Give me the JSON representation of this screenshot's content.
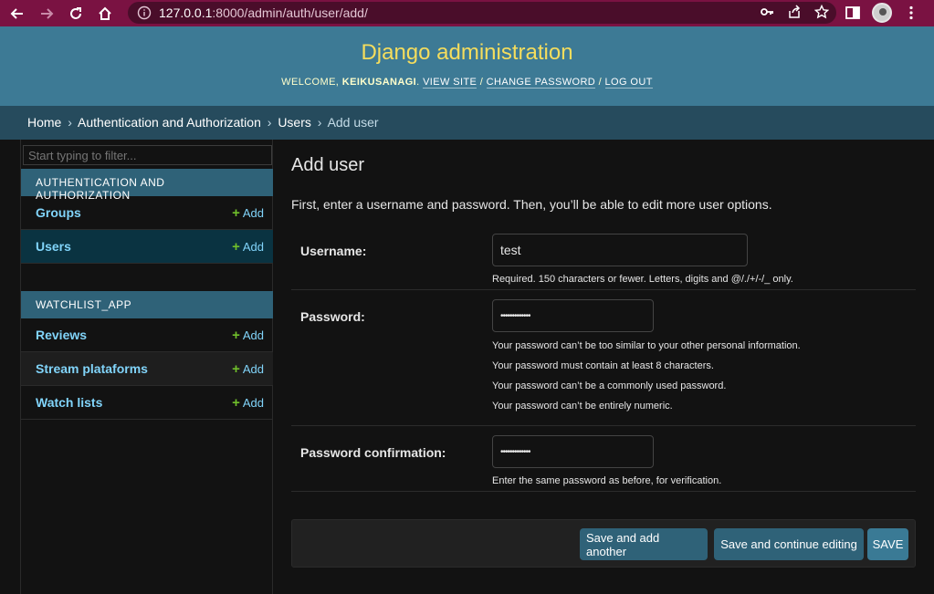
{
  "browser": {
    "url_host": "127.0.0.1",
    "url_path": ":8000/admin/auth/user/add/"
  },
  "header": {
    "site_title": "Django administration",
    "welcome": "WELCOME,",
    "username": "KEIKUSANAGI",
    "view_site": "VIEW SITE",
    "change_password": "CHANGE PASSWORD",
    "log_out": "LOG OUT",
    "sep1": ". ",
    "sep2": " / ",
    "sep3": " / "
  },
  "breadcrumbs": {
    "home": "Home",
    "app": "Authentication and Authorization",
    "model": "Users",
    "current": "Add user",
    "sep": "›"
  },
  "sidebar": {
    "filter_placeholder": "Start typing to filter...",
    "modules": [
      {
        "caption": "AUTHENTICATION AND AUTHORIZATION",
        "items": [
          {
            "name": "Groups",
            "add": "Add"
          },
          {
            "name": "Users",
            "add": "Add"
          }
        ]
      },
      {
        "caption": "WATCHLIST_APP",
        "items": [
          {
            "name": "Reviews",
            "add": "Add"
          },
          {
            "name": "Stream plataforms",
            "add": "Add"
          },
          {
            "name": "Watch lists",
            "add": "Add"
          }
        ]
      }
    ]
  },
  "main": {
    "title": "Add user",
    "intro": "First, enter a username and password. Then, you’ll be able to edit more user options.",
    "username": {
      "label": "Username:",
      "value": "test",
      "help": "Required. 150 characters or fewer. Letters, digits and @/./+/-/_ only."
    },
    "password": {
      "label": "Password:",
      "value": "•••••••••••••",
      "help": [
        "Your password can’t be too similar to your other personal information.",
        "Your password must contain at least 8 characters.",
        "Your password can’t be a commonly used password.",
        "Your password can’t be entirely numeric."
      ]
    },
    "password_confirmation": {
      "label": "Password confirmation:",
      "value": "•••••••••••••",
      "help": "Enter the same password as before, for verification."
    },
    "buttons": {
      "save_add_another": "Save and add another",
      "save_continue": "Save and continue editing",
      "save": "SAVE"
    }
  },
  "colors": {
    "header_bg": "#3d7a95",
    "title": "#f5dd5d",
    "breadcrumb_bg": "#264b5d",
    "link": "#81d4fa",
    "add_plus": "#70bf2b",
    "chrome_bg": "#7a1242"
  }
}
